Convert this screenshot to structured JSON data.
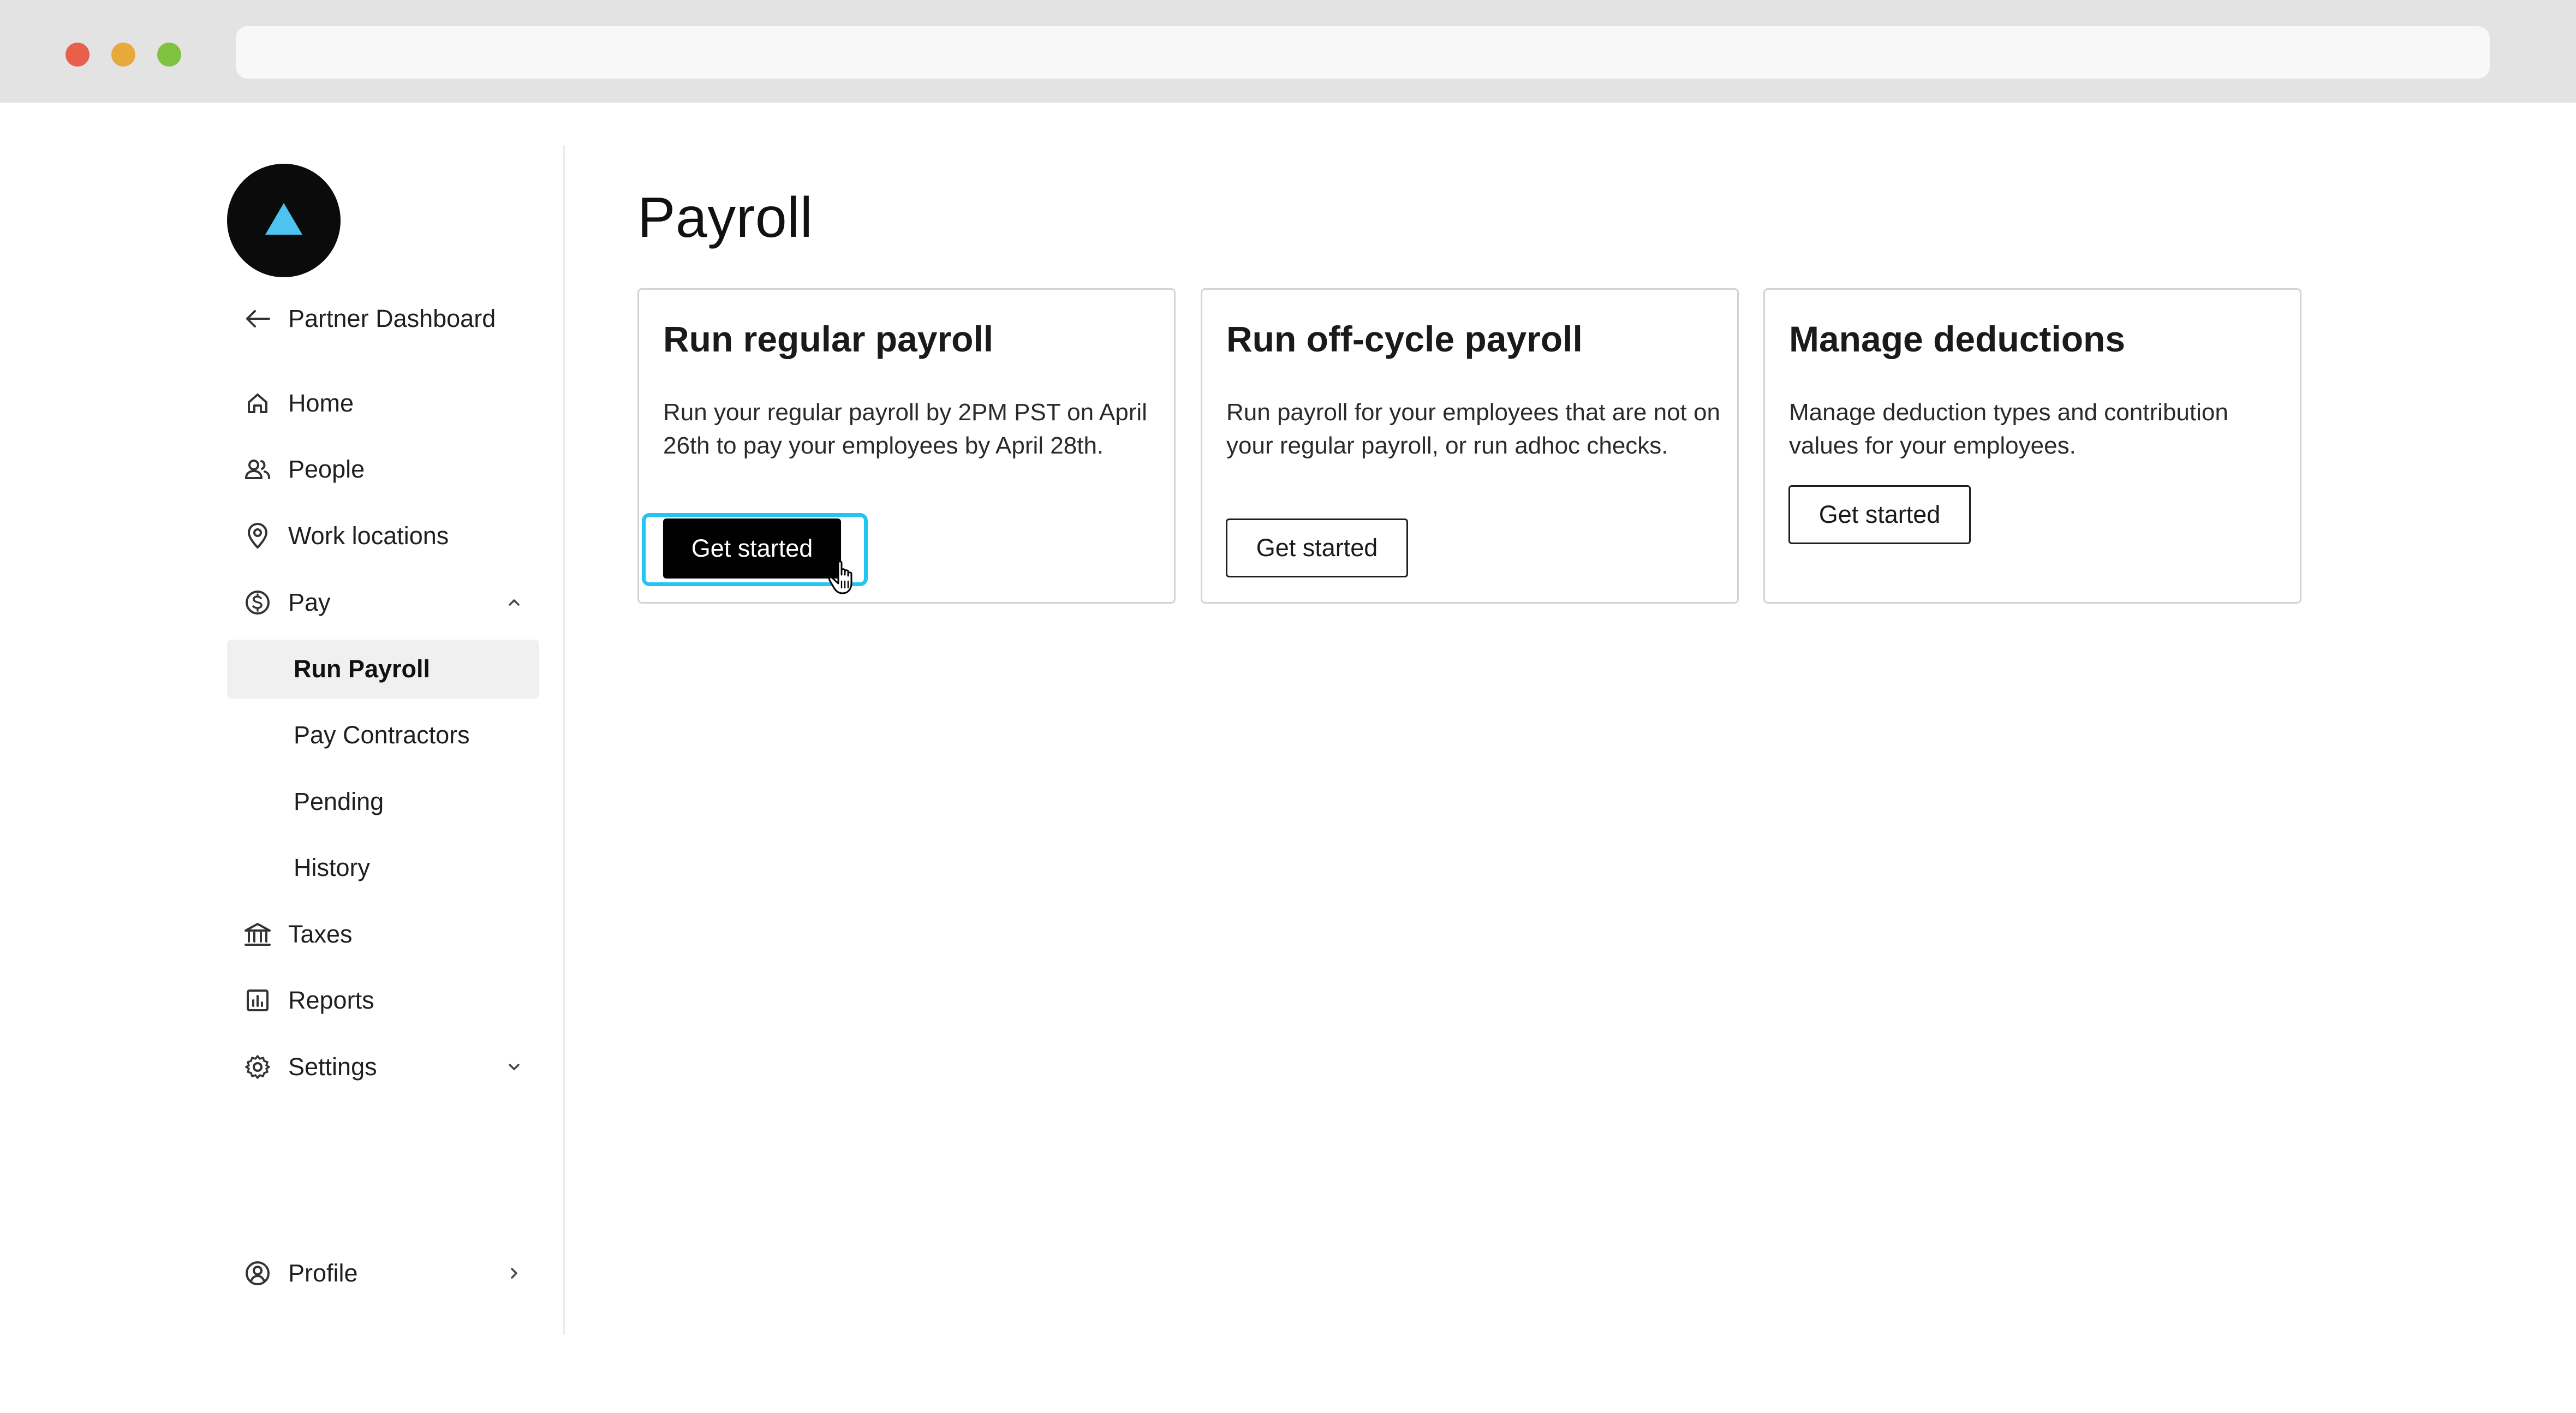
{
  "window": {
    "controls": [
      "close",
      "minimize",
      "maximize"
    ],
    "address_bar": ""
  },
  "brand": {
    "logo_icon": "triangle-logo-icon",
    "logo_bg": "#0b0b0b",
    "logo_accent": "#4cc3f0"
  },
  "sidebar": {
    "back_link": {
      "label": "Partner Dashboard",
      "icon": "arrow-left-icon"
    },
    "items": [
      {
        "label": "Home",
        "icon": "home-icon"
      },
      {
        "label": "People",
        "icon": "people-icon"
      },
      {
        "label": "Work locations",
        "icon": "location-pin-icon"
      },
      {
        "label": "Pay",
        "icon": "dollar-circle-icon",
        "expanded": true
      },
      {
        "label": "Taxes",
        "icon": "bank-icon"
      },
      {
        "label": "Reports",
        "icon": "report-chart-icon"
      },
      {
        "label": "Settings",
        "icon": "gear-icon",
        "expanded": false
      }
    ],
    "pay_subitems": [
      {
        "label": "Run Payroll",
        "active": true
      },
      {
        "label": "Pay Contractors"
      },
      {
        "label": "Pending"
      },
      {
        "label": "History"
      }
    ],
    "profile": {
      "label": "Profile",
      "icon": "user-circle-icon"
    }
  },
  "main": {
    "title": "Payroll",
    "cards": [
      {
        "title": "Run regular payroll",
        "description": "Run your regular payroll by 2PM PST on April 26th to pay your employees by April 28th.",
        "button": "Get started"
      },
      {
        "title": "Run off-cycle payroll",
        "description": "Run payroll for your employees that are not on your regular payroll, or run adhoc checks.",
        "button": "Get started"
      },
      {
        "title": "Manage deductions",
        "description": "Manage deduction types and contribution values for your employees.",
        "button": "Get started"
      }
    ]
  },
  "colors": {
    "focus_ring": "#22c6f0",
    "primary_button": "#000000",
    "active_nav_bg": "#f0f0f0"
  }
}
